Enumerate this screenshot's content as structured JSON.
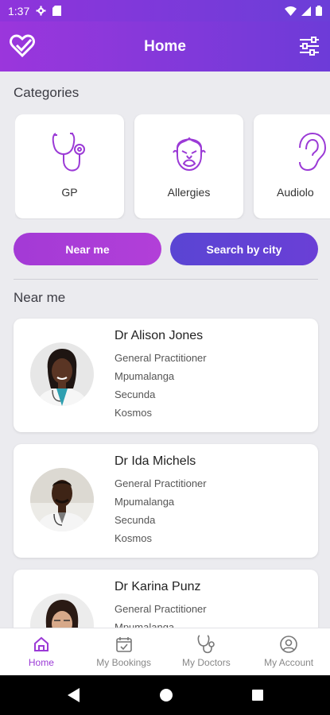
{
  "status_bar": {
    "time": "1:37"
  },
  "app_bar": {
    "title": "Home"
  },
  "categories": {
    "heading": "Categories",
    "items": [
      {
        "label": "GP",
        "icon": "stethoscope-icon"
      },
      {
        "label": "Allergies",
        "icon": "sneezing-face-icon"
      },
      {
        "label": "Audiolo",
        "icon": "ear-icon"
      }
    ]
  },
  "toggle": {
    "near_me": "Near me",
    "search_by_city": "Search by city"
  },
  "near_me": {
    "heading": "Near me",
    "doctors": [
      {
        "name": "Dr Alison Jones",
        "specialty": "General Practitioner",
        "province": "Mpumalanga",
        "city": "Secunda",
        "area": "Kosmos"
      },
      {
        "name": "Dr Ida Michels",
        "specialty": "General Practitioner",
        "province": "Mpumalanga",
        "city": "Secunda",
        "area": "Kosmos"
      },
      {
        "name": "Dr Karina Punz",
        "specialty": "General Practitioner",
        "province": "Mpumalanga",
        "city": "",
        "area": ""
      }
    ]
  },
  "bottom_nav": {
    "items": [
      {
        "label": "Home",
        "icon": "home-icon",
        "active": true
      },
      {
        "label": "My Bookings",
        "icon": "calendar-check-icon",
        "active": false
      },
      {
        "label": "My Doctors",
        "icon": "stethoscope-icon",
        "active": false
      },
      {
        "label": "My Account",
        "icon": "user-circle-icon",
        "active": false
      }
    ]
  },
  "colors": {
    "primary": "#9b36dc",
    "secondary": "#6d3bd8",
    "accent_icon": "#9b3ad6"
  }
}
